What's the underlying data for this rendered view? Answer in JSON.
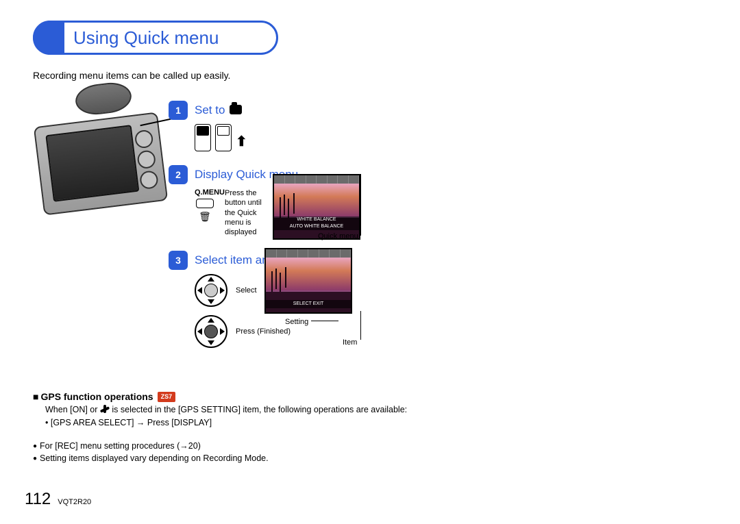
{
  "title": "Using Quick menu",
  "intro": "Recording menu items can be called up easily.",
  "steps": {
    "s1": {
      "title_pre": "Set to "
    },
    "s2": {
      "title": "Display Quick menu",
      "qmenu_label": "Q.MENU",
      "press_text": "Press the button until the Quick menu is displayed"
    },
    "s3": {
      "title": "Select item and setting",
      "select_label": "Select",
      "press_label": "Press (Finished)"
    }
  },
  "lcd": {
    "qm_callout": "Quick menu",
    "banner1a": "WHITE BALANCE",
    "banner1b": "AUTO WHITE BALANCE",
    "banner2": "SELECT     EXIT",
    "setting_callout": "Setting",
    "item_callout": "Item"
  },
  "gps": {
    "heading": "GPS function operations",
    "badge": "ZS7",
    "body_pre": "When [ON] or ",
    "body_post": " is selected in the [GPS SETTING] item, the following operations are available:",
    "sub": "• [GPS AREA SELECT] → Press [DISPLAY]"
  },
  "bullets": {
    "b1": "For [REC] menu setting procedures (→20)",
    "b2": "Setting items displayed vary depending on Recording Mode."
  },
  "footer": {
    "page": "112",
    "doc": "VQT2R20"
  }
}
